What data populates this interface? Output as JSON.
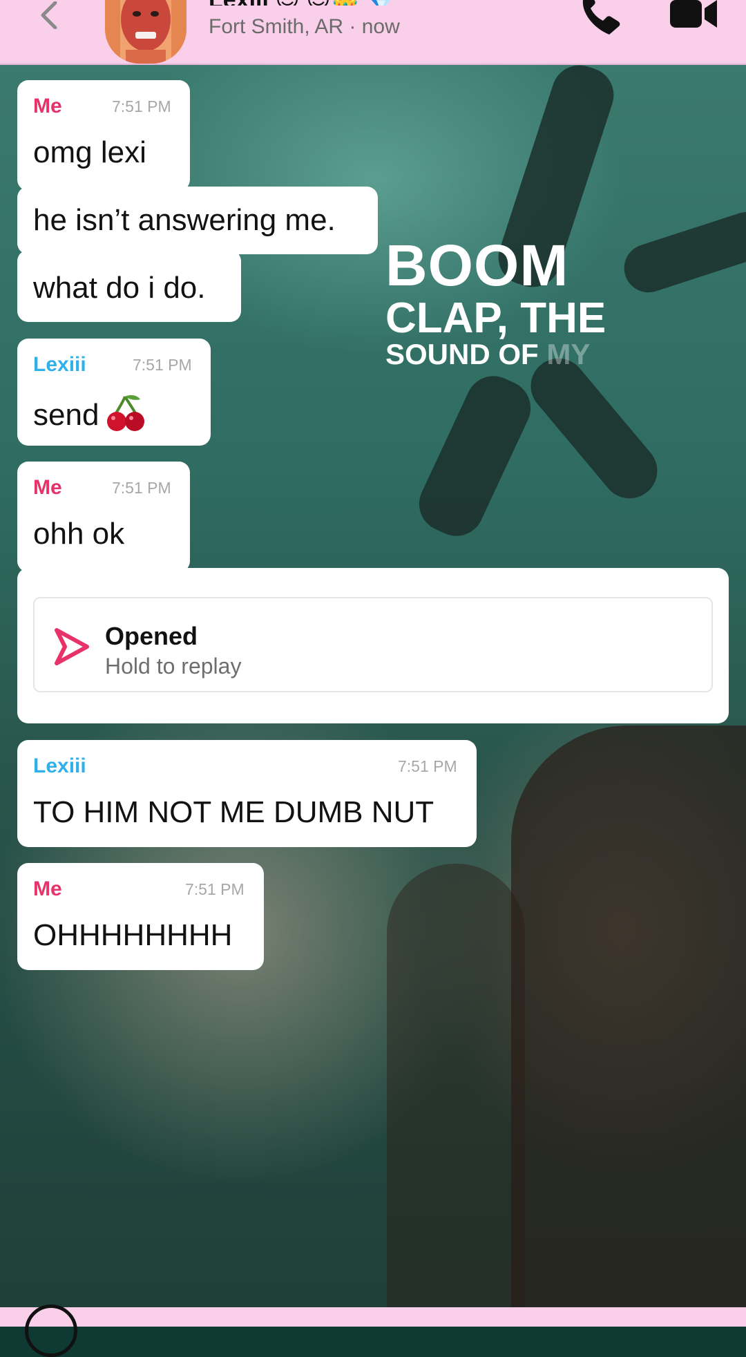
{
  "header": {
    "title": "Lexiii 😊 😊👑 💎",
    "subtitle": "Fort Smith, AR · now"
  },
  "overlay": {
    "line1": "BOOM",
    "line2": "CLAP, THE",
    "line3_main": "SOUND OF ",
    "line3_faded": "MY"
  },
  "messages": [
    {
      "sender": "Me",
      "time": "7:51 PM",
      "lines": [
        "omg lexi",
        "he isn’t answering me.",
        "what do i do."
      ]
    },
    {
      "sender": "Lexiii",
      "time": "7:51 PM",
      "lines": [
        "send"
      ],
      "emoji": "cherry-icon"
    },
    {
      "sender": "Me",
      "time": "7:51 PM",
      "lines": [
        "ohh ok"
      ]
    },
    {
      "sender": "Lexiii",
      "time": "7:51 PM",
      "lines": [
        "TO HIM NOT ME DUMB NUT"
      ]
    },
    {
      "sender": "Me",
      "time": "7:51 PM",
      "lines": [
        "OHHHHHHHH"
      ]
    }
  ],
  "snap": {
    "title": "Opened",
    "subtitle": "Hold to replay"
  },
  "colors": {
    "header_bg": "#f9cfe9",
    "me": "#e8336a",
    "lexiii": "#2fb0ea",
    "snap_arrow": "#e8336a"
  }
}
